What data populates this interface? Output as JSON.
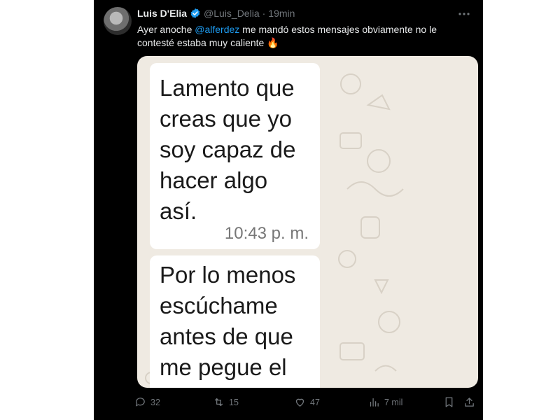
{
  "tweet": {
    "author_name": "Luis D'Elia",
    "handle": "@Luis_Delia",
    "separator": "·",
    "time": "19min",
    "text_before": "Ayer anoche ",
    "mention": "@alferdez",
    "text_after": " me mandó estos mensajes obviamente no le contesté estaba muy caliente 🔥"
  },
  "chat": {
    "message_1": "Lamento que creas que yo soy capaz de hacer algo así.",
    "message_1_time": "10:43 p. m.",
    "message_2": "Por lo menos escúchame antes de que me pegue el"
  },
  "actions": {
    "replies": "32",
    "reposts": "15",
    "likes": "47",
    "views": "7 mil"
  },
  "colors": {
    "background": "#000000",
    "text": "#e7e9ea",
    "muted": "#71767b",
    "accent": "#1d9bf0",
    "chat_wallpaper": "#efeae2"
  },
  "icons": [
    "verified-badge-icon",
    "more-icon",
    "reply-icon",
    "repost-icon",
    "like-icon",
    "views-icon",
    "bookmark-icon",
    "share-icon"
  ]
}
